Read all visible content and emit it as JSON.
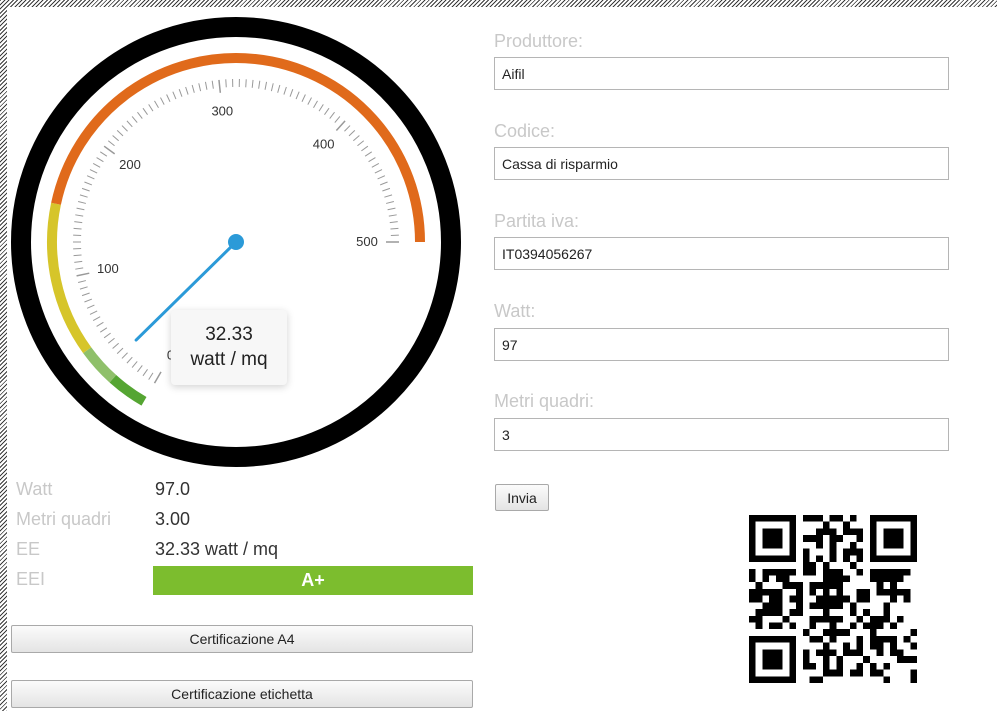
{
  "gauge": {
    "min": 0,
    "max": 500,
    "value": 32.33,
    "tick_labels": [
      "0",
      "100",
      "200",
      "300",
      "400",
      "500"
    ],
    "bands": [
      {
        "from": 0,
        "to": 25,
        "color": "#55a532"
      },
      {
        "from": 25,
        "to": 50,
        "color": "#8fc06a"
      },
      {
        "from": 50,
        "to": 150,
        "color": "#d6c52a"
      },
      {
        "from": 150,
        "to": 500,
        "color": "#e06a1b"
      }
    ],
    "needle_color": "#2b9ad8",
    "readout_value": "32.33",
    "readout_unit": "watt / mq"
  },
  "stats": [
    {
      "label": "Watt",
      "value": "97.0"
    },
    {
      "label": "Metri quadri",
      "value": "3.00"
    },
    {
      "label": "EE",
      "value": "32.33 watt / mq"
    },
    {
      "label": "EEI",
      "value": "A+"
    }
  ],
  "eei_color": "#7cbd2e",
  "buttons": {
    "a4": "Certificazione A4",
    "label": "Certificazione etichetta",
    "submit": "Invia"
  },
  "form": {
    "produttore": {
      "label": "Produttore:",
      "value": "Aifil"
    },
    "codice": {
      "label": "Codice:",
      "value": "Cassa di risparmio"
    },
    "partita_iva": {
      "label": "Partita iva:",
      "value": "IT0394056267"
    },
    "watt": {
      "label": "Watt:",
      "value": "97"
    },
    "metri_quadri": {
      "label": "Metri quadri:",
      "value": "3"
    }
  },
  "qr_icon": "qr-code"
}
